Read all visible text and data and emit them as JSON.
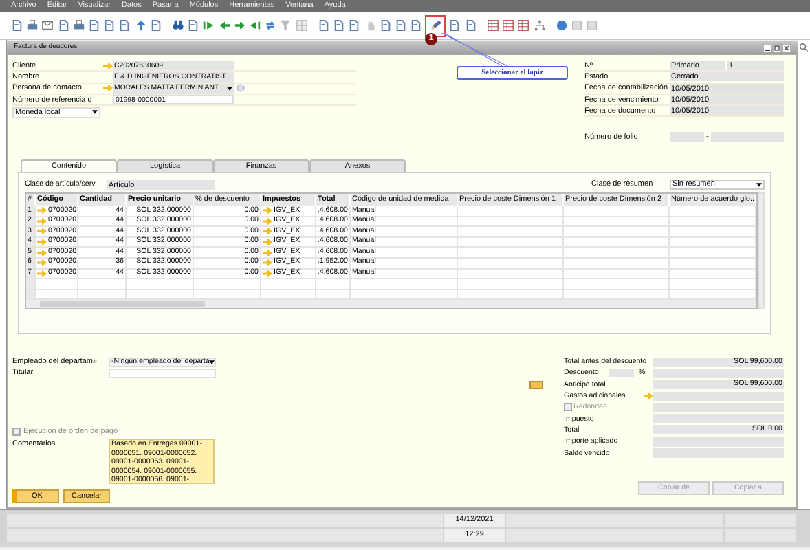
{
  "menu": [
    "Archivo",
    "Editar",
    "Visualizar",
    "Datos",
    "Pasar a",
    "Módulos",
    "Herramientas",
    "Ventana",
    "Ayuda"
  ],
  "callout": {
    "badge": "1",
    "text": "Seleccionar el lapiz"
  },
  "window": {
    "title": "Factura de deudores"
  },
  "header_left": [
    {
      "label": "Cliente",
      "value": "C20207630609",
      "kind": "link"
    },
    {
      "label": "Nombre",
      "value": "F & D INGENIEROS CONTRATIST",
      "kind": "readonly"
    },
    {
      "label": "Persona de contacto",
      "value": "MORALES MATTA FERMIN ANT",
      "kind": "dropdown"
    },
    {
      "label": "Número de referencia d",
      "value": "01998-0000001",
      "kind": "input"
    }
  ],
  "currency": {
    "value": "Moneda local"
  },
  "header_right": [
    {
      "label": "Nº",
      "series": "Primario",
      "value": "1"
    },
    {
      "label": "Estado",
      "value": "Cerrado"
    },
    {
      "label": "Fecha de contabilización",
      "value": "10/05/2010"
    },
    {
      "label": "Fecha de vencimiento",
      "value": "10/05/2010"
    },
    {
      "label": "Fecha de documento",
      "value": "10/05/2010"
    }
  ],
  "folio": {
    "label": "Número de folio",
    "separator": "-"
  },
  "tabs": [
    {
      "label": "Contenido",
      "selected": true
    },
    {
      "label": "Logística",
      "selected": false
    },
    {
      "label": "Finanzas",
      "selected": false
    },
    {
      "label": "Anexos",
      "selected": false
    }
  ],
  "item_type": {
    "label": "Clase de artículo/serv",
    "value": "Artículo"
  },
  "summary": {
    "label": "Clase de resumen",
    "value": "Sin resumen"
  },
  "table": {
    "columns": [
      {
        "label": "#",
        "bold": false,
        "link": false
      },
      {
        "label": "Código",
        "bold": true,
        "link": true
      },
      {
        "label": "Cantidad",
        "bold": true,
        "link": false
      },
      {
        "label": "Precio unitario",
        "bold": true,
        "link": false
      },
      {
        "label": "% de descuento",
        "bold": false,
        "link": false
      },
      {
        "label": "Impuestos",
        "bold": true,
        "link": true
      },
      {
        "label": "Total",
        "bold": true,
        "link": false
      },
      {
        "label": "Código de unidad de medida",
        "bold": false,
        "link": false
      },
      {
        "label": "Precio de coste Dimensión 1",
        "bold": false,
        "link": false
      },
      {
        "label": "Precio de coste Dimensión 2",
        "bold": false,
        "link": false
      },
      {
        "label": "Número de acuerdo glo...",
        "bold": false,
        "link": false
      }
    ],
    "rows": [
      [
        "1",
        "0700020",
        "44",
        "SOL 332.000000",
        "0.00",
        "IGV_EX",
        ".4,608.00",
        "Manual"
      ],
      [
        "2",
        "0700020",
        "44",
        "SOL 332.000000",
        "0.00",
        "IGV_EX",
        ".4,608.00",
        "Manual"
      ],
      [
        "3",
        "0700020",
        "44",
        "SOL 332.000000",
        "0.00",
        "IGV_EX",
        ".4,608.00",
        "Manual"
      ],
      [
        "4",
        "0700020",
        "44",
        "SOL 332.000000",
        "0.00",
        "IGV_EX",
        ".4,608.00",
        "Manual"
      ],
      [
        "5",
        "0700020",
        "44",
        "SOL 332.000000",
        "0.00",
        "IGV_EX",
        ".4,608.00",
        "Manual"
      ],
      [
        "6",
        "0700020",
        "36",
        "SOL 332.000000",
        "0.00",
        "IGV_EX",
        ".1,952.00",
        "Manual"
      ],
      [
        "7",
        "0700020",
        "44",
        "SOL 332.000000",
        "0.00",
        "IGV_EX",
        ".4,608.00",
        "Manual"
      ]
    ]
  },
  "employee": {
    "label": "Empleado del departam»",
    "value": "-Ningún empleado del departa"
  },
  "owner": {
    "label": "Titular"
  },
  "payment_order": {
    "label": "Ejecución de orden de pago",
    "checked": false
  },
  "comments": {
    "label": "Comentarios",
    "value": "Basado en Entregas 09001-0000051. 09001-0000052. 09001-0000053. 09001-0000054. 09001-0000055. 09001-0000056. 09001-"
  },
  "totals": [
    {
      "label": "Total antes del descuento",
      "value": "SOL 99,600.00",
      "kind": "plain"
    },
    {
      "label": "Descuento",
      "unit": "%",
      "kind": "percent"
    },
    {
      "label": "Anticipo total",
      "value": "SOL 99,600.00",
      "button": "...",
      "kind": "button"
    },
    {
      "label": "Gastos adicionales",
      "kind": "link"
    },
    {
      "label": "Redondeo",
      "checked": false,
      "kind": "checkbox"
    },
    {
      "label": "Impuesto",
      "kind": "plain"
    },
    {
      "label": "Total",
      "value": "SOL 0.00",
      "kind": "plain"
    },
    {
      "label": "Importe aplicado",
      "kind": "plain"
    },
    {
      "label": "Saldo vencido",
      "kind": "plain"
    }
  ],
  "buttons": [
    {
      "label": "OK",
      "disabled": false,
      "primary": true
    },
    {
      "label": "Cancelar",
      "disabled": false,
      "primary": false
    }
  ],
  "copy_buttons": [
    {
      "label": "Copiar de",
      "disabled": true
    },
    {
      "label": "Copiar a",
      "disabled": true
    }
  ],
  "status_bar": {
    "date": "14/12/2021",
    "time": "12:29"
  }
}
